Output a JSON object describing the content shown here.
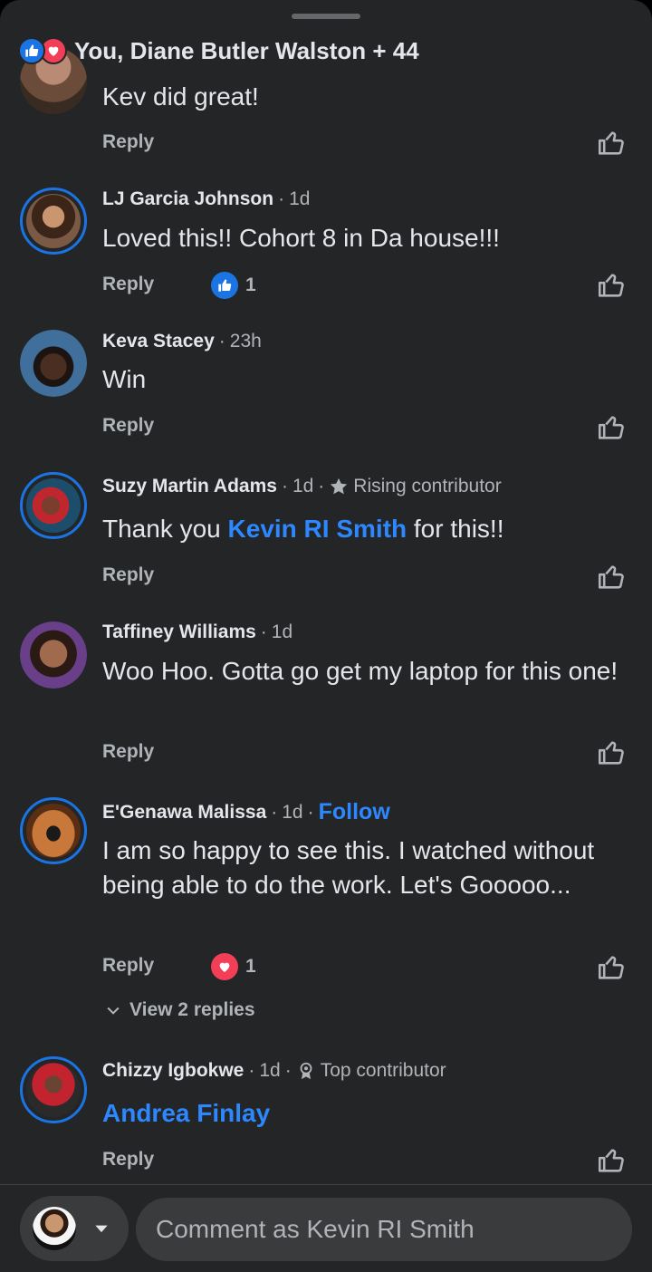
{
  "reactions_summary": {
    "text": "You, Diane Butler Walston + 44"
  },
  "first_comment": {
    "text": "Kev did great!",
    "reply_label": "Reply"
  },
  "comments": [
    {
      "name": "LJ Garcia Johnson",
      "time": "1d",
      "text": "Loved this!! Cohort 8 in Da house!!!",
      "reply_label": "Reply",
      "reaction_count": "1"
    },
    {
      "name": "Keva Stacey",
      "time": "23h",
      "text": "Win",
      "reply_label": "Reply"
    },
    {
      "name": "Suzy Martin Adams",
      "time": "1d",
      "badge": "Rising contributor",
      "text_before": "Thank you",
      "mention": "Kevin RI Smith",
      "text_after": "for this!!",
      "reply_label": "Reply"
    },
    {
      "name": "Taffiney Williams",
      "time": "1d",
      "text": "Woo Hoo. Gotta go get my laptop for this one!",
      "reply_label": "Reply"
    },
    {
      "name": "E'Genawa Malissa",
      "time": "1d",
      "follow_label": "Follow",
      "text": "I am so happy to see this. I watched without being able to do the work. Let's Gooooo...",
      "reply_label": "Reply",
      "reaction_count": "1",
      "view_replies": "View 2 replies"
    },
    {
      "name": "Chizzy Igbokwe",
      "time": "1d",
      "badge": "Top contributor",
      "mention": "Andrea Finlay",
      "reply_label": "Reply"
    }
  ],
  "composer": {
    "placeholder": "Comment as Kevin RI Smith"
  },
  "colors": {
    "accent": "#1b74e4",
    "link": "#2d88ff",
    "love": "#f33e58",
    "background": "#242526",
    "muted": "#b0b3b8"
  },
  "icons": [
    "like-reaction-icon",
    "love-reaction-icon",
    "thumbs-up-icon",
    "star-icon",
    "award-icon",
    "chevron-down-icon",
    "caret-down-icon"
  ]
}
